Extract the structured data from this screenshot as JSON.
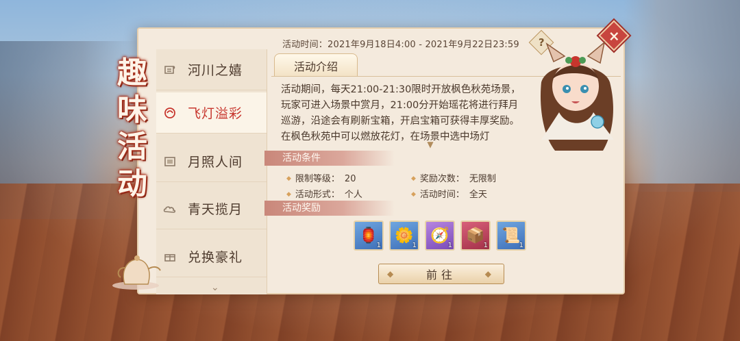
{
  "header": {
    "event_time": "活动时间：2021年9月18日4:00 - 2021年9月22日23:59",
    "help_symbol": "?",
    "close_symbol": "×"
  },
  "title_vertical": [
    "趣",
    "味",
    "活",
    "动"
  ],
  "sidebar": {
    "items": [
      {
        "label": "河川之嬉",
        "icon": "scroll-icon",
        "active": false
      },
      {
        "label": "飞灯溢彩",
        "icon": "lantern-icon",
        "active": true
      },
      {
        "label": "月照人间",
        "icon": "frame-icon",
        "active": false
      },
      {
        "label": "青天揽月",
        "icon": "cloud-icon",
        "active": false
      },
      {
        "label": "兑换豪礼",
        "icon": "gift-icon",
        "active": false
      }
    ],
    "more_symbol": "⌄"
  },
  "content": {
    "intro_tab": "活动介绍",
    "description": "活动期间，每天21:00-21:30限时开放枫色秋苑场景，玩家可进入场景中赏月，21:00分开始瑶花将进行拜月巡游，沿途会有刷新宝箱，开启宝箱可获得丰厚奖励。在枫色秋苑中可以燃放花灯，在场景中选中场灯",
    "conditions_title": "活动条件",
    "conditions": [
      {
        "key": "限制等级：",
        "value": "20"
      },
      {
        "key": "奖励次数：",
        "value": "无限制"
      },
      {
        "key": "活动形式：",
        "value": "个人"
      },
      {
        "key": "活动时间：",
        "value": "全天"
      }
    ],
    "rewards_title": "活动奖励",
    "rewards": [
      {
        "name": "lantern-item",
        "quality": "blue",
        "count": "1",
        "glyph": "🏮"
      },
      {
        "name": "flower-item",
        "quality": "blue",
        "count": "1",
        "glyph": "🌼"
      },
      {
        "name": "compass-item",
        "quality": "purple",
        "count": "1",
        "glyph": "🧭"
      },
      {
        "name": "chest-item",
        "quality": "red",
        "count": "1",
        "glyph": "📦"
      },
      {
        "name": "scroll-item",
        "quality": "blue",
        "count": "1",
        "glyph": "📜"
      }
    ],
    "go_button": "前往"
  },
  "colors": {
    "accent_red": "#c7352d",
    "panel_bg": "#f4eadd",
    "section_bar": "#c9877a"
  }
}
